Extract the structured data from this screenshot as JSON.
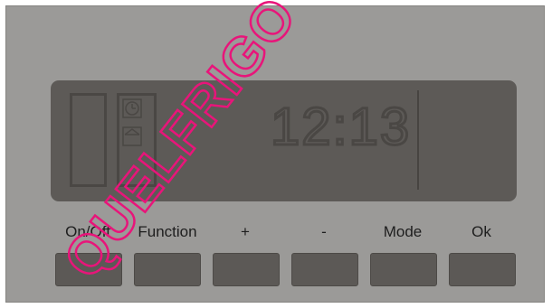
{
  "display": {
    "time": "12:13",
    "icons": [
      "clock-icon",
      "food-tray-icon"
    ]
  },
  "buttons": [
    {
      "key": "on_off",
      "label": "On/Off"
    },
    {
      "key": "function",
      "label": "Function"
    },
    {
      "key": "plus",
      "label": "+"
    },
    {
      "key": "minus",
      "label": "-"
    },
    {
      "key": "mode",
      "label": "Mode"
    },
    {
      "key": "ok",
      "label": "Ok"
    }
  ],
  "watermark": {
    "text": "QUELFRIGO",
    "color": "#e8157a"
  },
  "colors": {
    "panel": "#9b9a98",
    "lcd": "#5d5a57",
    "lcd_segment": "#4a4744",
    "button": "#5c5956"
  }
}
